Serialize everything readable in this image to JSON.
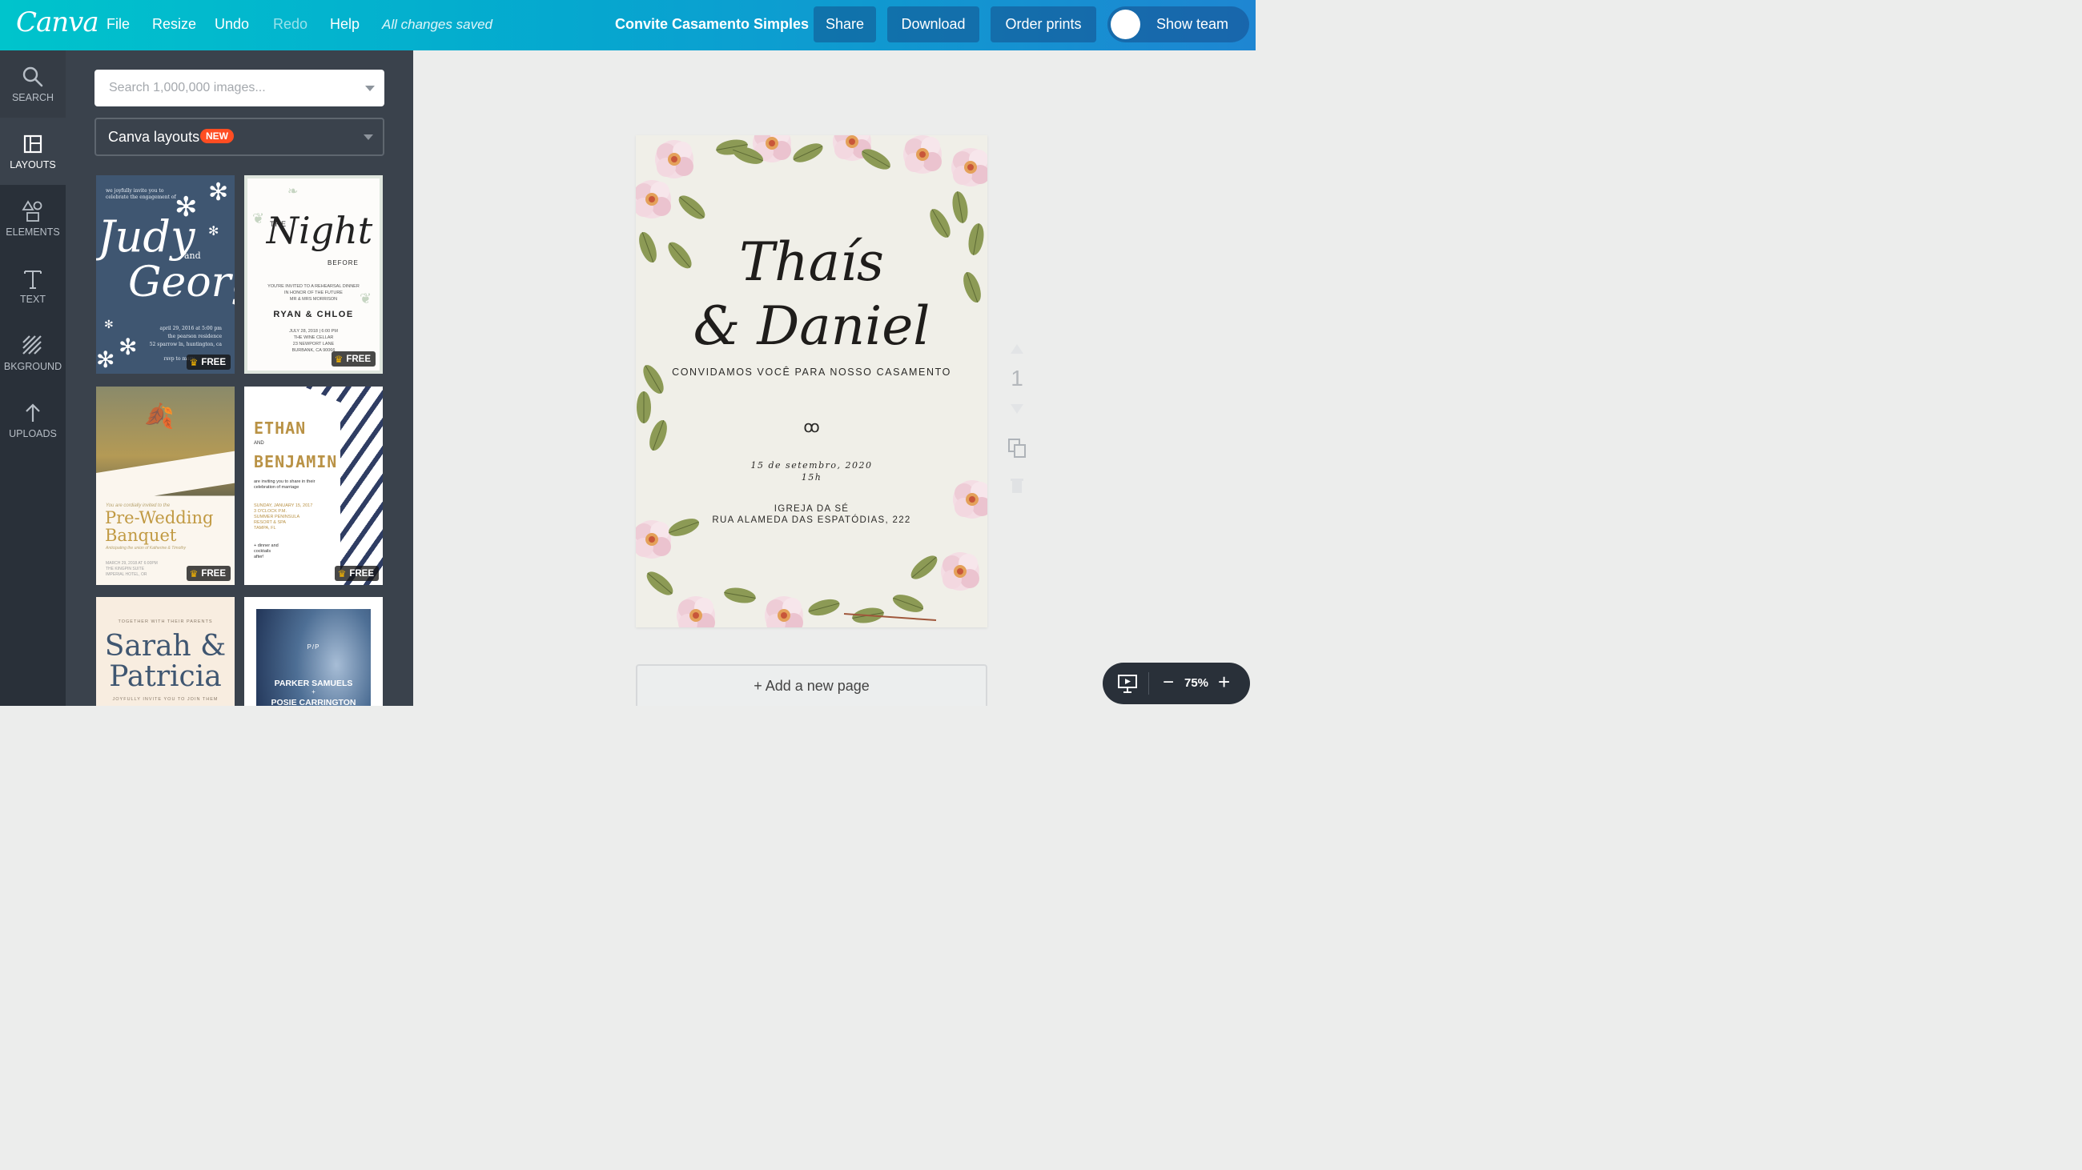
{
  "app": {
    "logo": "Canva"
  },
  "menu": {
    "file": "File",
    "resize": "Resize",
    "undo": "Undo",
    "redo": "Redo",
    "help": "Help",
    "saved_status": "All changes saved"
  },
  "document": {
    "title": "Convite Casamento Simples"
  },
  "toolbar": {
    "share": "Share",
    "download": "Download",
    "order_prints": "Order prints",
    "show_team": "Show team"
  },
  "sidebar": {
    "items": [
      {
        "label": "SEARCH",
        "icon": "search-icon"
      },
      {
        "label": "LAYOUTS",
        "icon": "layouts-icon"
      },
      {
        "label": "ELEMENTS",
        "icon": "elements-icon"
      },
      {
        "label": "TEXT",
        "icon": "text-icon"
      },
      {
        "label": "BKGROUND",
        "icon": "background-icon"
      },
      {
        "label": "UPLOADS",
        "icon": "upload-icon"
      }
    ]
  },
  "panel": {
    "search_placeholder": "Search 1,000,000 images...",
    "layout_select": "Canva layouts",
    "new_badge": "NEW",
    "free_label": "FREE",
    "templates": [
      {
        "lines": [
          "we joyfully invite you to",
          "celebrate the engagement of",
          "Judy",
          "and",
          "George",
          "april 29, 2016 at 5:00 pm",
          "the pearson residence",
          "52 sparrow ln, huntington, ca",
          "rsvp to mary"
        ]
      },
      {
        "lines": [
          "THE",
          "Night",
          "BEFORE",
          "YOU'RE INVITED TO A REHEARSAL DINNER",
          "IN HONOR OF THE FUTURE",
          "MR & MRS MORRISON",
          "RYAN & CHLOE",
          "JULY 28, 2018 | 6:00 PM",
          "THE WINE CELLAR",
          "23 NEWPORT LANE",
          "BURBANK, CA 90066"
        ]
      },
      {
        "lines": [
          "You are cordially invited to the",
          "Pre-Wedding",
          "Banquet",
          "Anticipating the union of Katherine & Timothy",
          "MARCH 29, 2018 AT 6:00PM",
          "THE KINGPIN SUITE",
          "IMPERIAL HOTEL, OR"
        ]
      },
      {
        "lines": [
          "ETHAN",
          "AND",
          "BENJAMIN",
          "are inviting you to share in their",
          "celebration of marriage",
          "SUNDAY, JANUARY 15, 2017",
          "3 O'CLOCK P.M.",
          "SUMMER PENINSULA",
          "RESORT & SPA",
          "TAMPA, FL",
          "+ dinner and",
          "cocktails",
          "after!"
        ]
      },
      {
        "lines": [
          "TOGETHER WITH THEIR PARENTS",
          "Sarah &",
          "Patricia",
          "JOYFULLY INVITE YOU TO JOIN THEM"
        ]
      },
      {
        "lines": [
          "P/P",
          "PARKER SAMUELS",
          "+",
          "POSIE CARRINGTON"
        ]
      }
    ]
  },
  "design": {
    "name_line1": "Thaís",
    "name_line2": "& Daniel",
    "invite_line": "CONVIDAMOS VOCÊ PARA NOSSO CASAMENTO",
    "ornament": "ꝏ",
    "date": "15 de setembro, 2020",
    "time": "15h",
    "venue_line1": "IGREJA DA SÉ",
    "venue_line2": "RUA ALAMEDA DAS ESPATÓDIAS, 222"
  },
  "page_controls": {
    "page_number": "1"
  },
  "add_page": "+ Add a new page",
  "zoom": {
    "value": "75%",
    "minus": "−",
    "plus": "+"
  },
  "colors": {
    "topbar_start": "#00c4cc",
    "topbar_end": "#1e86d2",
    "rail": "#293039",
    "panel": "#3a424c",
    "badge_new": "#ff4d22"
  }
}
